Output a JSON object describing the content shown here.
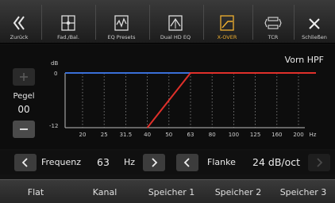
{
  "toolbar": {
    "back_label": "Zurück",
    "items": [
      {
        "label": "Fad./Bal.",
        "icon": "fader-balance-icon"
      },
      {
        "label": "EQ Presets",
        "icon": "eq-presets-icon"
      },
      {
        "label": "Dual HD EQ",
        "icon": "dual-hd-eq-icon"
      },
      {
        "label": "X-OVER",
        "icon": "crossover-icon",
        "active": true
      },
      {
        "label": "TCR",
        "icon": "tcr-icon"
      }
    ],
    "close_label": "Schließen"
  },
  "graph": {
    "title": "Vorn HPF",
    "db_unit": "dB",
    "y_top_label": "0",
    "y_bottom_label": "-12",
    "freq_ticks": [
      "20",
      "25",
      "31.5",
      "40",
      "50",
      "63",
      "80",
      "100",
      "125",
      "160",
      "200"
    ],
    "freq_unit": "Hz"
  },
  "chart_data": {
    "type": "line",
    "x": [
      "20",
      "25",
      "31.5",
      "40",
      "50",
      "63",
      "80",
      "100",
      "125",
      "160",
      "200"
    ],
    "series": [
      {
        "values_db": [
          0,
          0,
          0,
          0,
          0,
          0,
          0,
          0,
          0,
          0,
          0
        ],
        "color": "#3a6fd8"
      },
      {
        "values_db": [
          null,
          null,
          null,
          -12,
          -6,
          0,
          0,
          0,
          0,
          0,
          0
        ],
        "color": "#e0302a"
      }
    ],
    "ylim": [
      -12,
      0
    ],
    "grid": true
  },
  "level": {
    "label": "Pegel",
    "value": "00"
  },
  "params": {
    "freq_label": "Frequenz",
    "freq_value": "63",
    "freq_unit": "Hz",
    "slope_label": "Flanke",
    "slope_value": "24 dB/oct"
  },
  "presets": [
    "Flat",
    "Kanal",
    "Speicher 1",
    "Speicher 2",
    "Speicher 3"
  ],
  "colors": {
    "accent": "#f0b030",
    "flat_line": "#3a6fd8",
    "filter_line": "#e0302a"
  }
}
